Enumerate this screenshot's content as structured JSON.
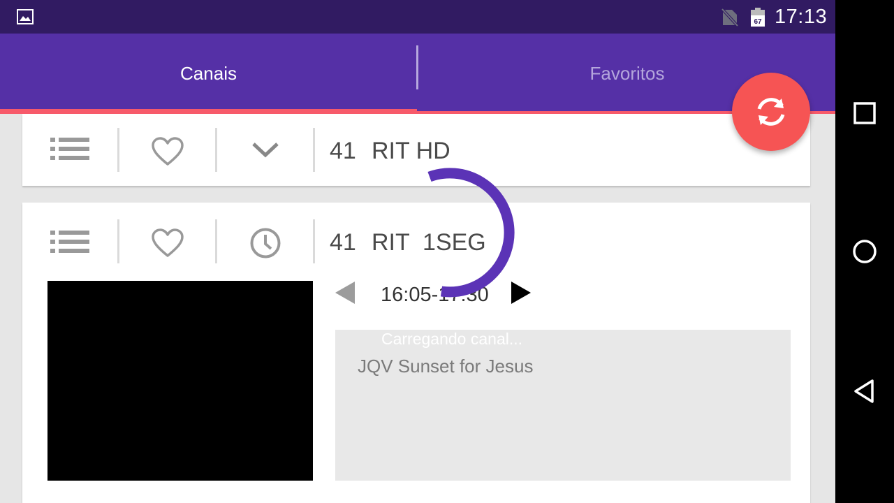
{
  "status_bar": {
    "time": "17:13",
    "battery_level": "67",
    "icons": [
      "gallery-icon",
      "no-sim-icon",
      "battery-icon"
    ]
  },
  "tabs": [
    {
      "label": "Canais",
      "selected": true
    },
    {
      "label": "Favoritos",
      "selected": false
    }
  ],
  "channels": [
    {
      "number": "41",
      "name": "RIT HD",
      "expanded": false,
      "icons": [
        "list-icon",
        "heart-icon",
        "chevron-down-icon"
      ]
    },
    {
      "number": "41",
      "name": "RIT  1SEG",
      "expanded": true,
      "icons": [
        "list-icon",
        "heart-icon",
        "clock-icon"
      ]
    }
  ],
  "program": {
    "time_range": "16:05-17:30",
    "loading_text": "Carregando canal...",
    "title": "JQV Sunset for Jesus"
  },
  "fab": {
    "icon": "refresh-icon"
  },
  "colors": {
    "status_bar": "#311b62",
    "tab_bar": "#5530a6",
    "tab_indicator": "#f75a6a",
    "fab": "#f65454",
    "spinner": "#5b33b6"
  }
}
